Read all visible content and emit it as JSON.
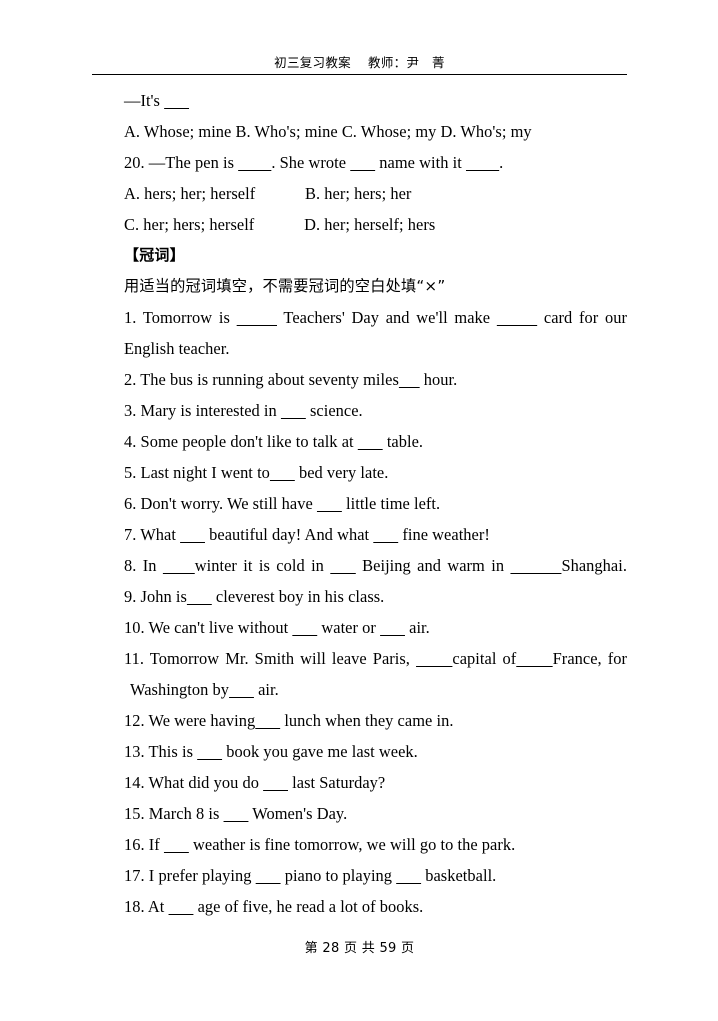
{
  "header": {
    "text": "初三复习教案　 教师：尹　菁"
  },
  "footer": {
    "text": "第 28 页 共 59 页"
  },
  "body": {
    "line_itsblank": "—It's ______",
    "line_19_options": "A. Whose; mine B. Who's; mine C. Whose; my D. Who's; my",
    "q20_stem": "20. —The pen is ________. She wrote ______ name with it ________.",
    "q20_options_ab": "A. hers; her; herself            B. her; hers; her",
    "q20_options_cd": "C. her; hers; herself            D. her; herself; hers",
    "section_heading": "【冠词】",
    "section_instruction": "用适当的冠词填空，不需要冠词的空白处填“×”",
    "q1_line1": "1. Tomorrow is ______ Teachers' Day and we'll make ______ card for our",
    "q1_line2": "English teacher.",
    "q2": "2. The bus is running about seventy miles_____ hour.",
    "q3": "3. Mary is interested in ______ science.",
    "q4": "4. Some people don't like to talk at ______ table.",
    "q5": "5. Last night I went to______ bed very late.",
    "q6": "6. Don't worry. We still have ______ little time left.",
    "q7": "7. What ______ beautiful day! And what ______ fine weather!",
    "q8": "8. In _____winter it is cold in ____ Beijing and warm in ________Shanghai.",
    "q9": "9. John is______ cleverest boy in his class.",
    "q10": "10. We can't live without ______ water or ______ air.",
    "q11_line1": "11. Tomorrow Mr. Smith will leave Paris, ______capital of______France, for",
    "q11_line2": "Washington by______ air.",
    "q12": "12. We were having______ lunch when they came in.",
    "q13": "13. This is ______ book you gave me last week.",
    "q14": "14. What did you do ______ last Saturday?",
    "q15": "15. March 8 is ______ Women's Day.",
    "q16": "16. If ______ weather is fine tomorrow, we will go to the park.",
    "q17": "17. I prefer playing ______ piano to playing ______ basketball.",
    "q18": "18. At ______ age of five, he read a lot of books."
  }
}
